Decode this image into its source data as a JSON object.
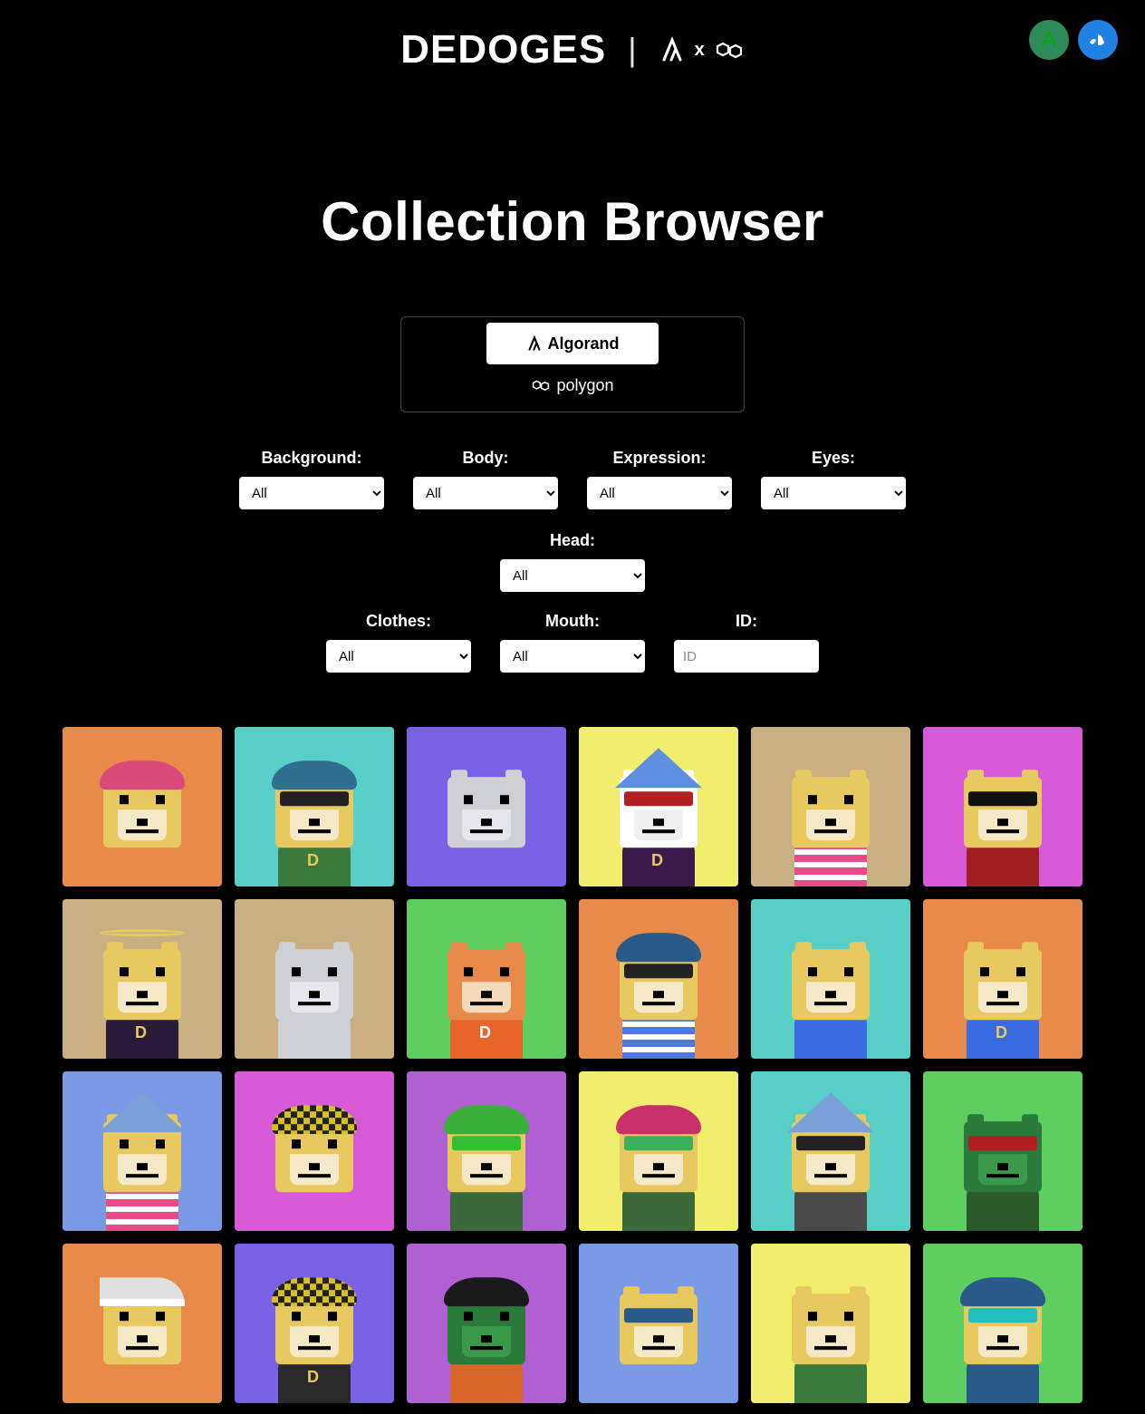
{
  "header": {
    "brand": "DEDOGES"
  },
  "page": {
    "title": "Collection Browser"
  },
  "blockchain": {
    "options": [
      {
        "label": "Algorand",
        "active": true
      },
      {
        "label": "polygon",
        "active": false
      }
    ]
  },
  "filters": {
    "row1": [
      {
        "key": "background",
        "label": "Background:",
        "value": "All"
      },
      {
        "key": "body",
        "label": "Body:",
        "value": "All"
      },
      {
        "key": "expression",
        "label": "Expression:",
        "value": "All"
      },
      {
        "key": "eyes",
        "label": "Eyes:",
        "value": "All"
      },
      {
        "key": "head",
        "label": "Head:",
        "value": "All"
      }
    ],
    "row2": [
      {
        "key": "clothes",
        "label": "Clothes:",
        "value": "All"
      },
      {
        "key": "mouth",
        "label": "Mouth:",
        "value": "All"
      }
    ],
    "id": {
      "label": "ID:",
      "placeholder": "ID"
    }
  },
  "grid": [
    {
      "bg": "#e78a4a",
      "body": "#e8c95f",
      "head": "#e8c95f",
      "snout": "#f5e9c8",
      "hat": "#d84a7a",
      "hatShape": "cap",
      "clothes": "#e78a4a"
    },
    {
      "bg": "#58cfc6",
      "body": "#e8c95f",
      "head": "#e8c95f",
      "snout": "#f5e9c8",
      "hat": "#2f6e8f",
      "hatShape": "cap",
      "clothes": "#3a7a3a",
      "glasses": "#222",
      "letter": "D",
      "letterColor": "#e8c95f"
    },
    {
      "bg": "#7a62e6",
      "body": "#cfcfd6",
      "head": "#cfcfd6",
      "snout": "#e6e6ec",
      "clothes": "#7a62e6"
    },
    {
      "bg": "#f2ee6d",
      "body": "#e8c95f",
      "head": "#ffffff",
      "snout": "#f0f0f0",
      "hat": "#5e8fe0",
      "hatShape": "triangle",
      "hatBorder": "#5e8fe0",
      "clothes": "#3a1a4a",
      "glasses": "#b02020",
      "letter": "D",
      "letterColor": "#e8c95f"
    },
    {
      "bg": "#c9b083",
      "body": "#e8c95f",
      "head": "#e8c95f",
      "snout": "#f5e9c8",
      "clothes": "#e84a8a",
      "stripes": true
    },
    {
      "bg": "#d85ad8",
      "body": "#e8c95f",
      "head": "#e8c95f",
      "snout": "#f5e9c8",
      "glasses": "#111",
      "clothes": "#a02020"
    },
    {
      "bg": "#c9b083",
      "body": "#e8c95f",
      "head": "#e8c95f",
      "snout": "#f5e9c8",
      "hat": "#e8c95f",
      "hatShape": "halo",
      "clothes": "#2a1a3a",
      "letter": "D",
      "letterColor": "#e8c95f"
    },
    {
      "bg": "#c9b083",
      "body": "#cfcfd6",
      "head": "#cfcfd6",
      "snout": "#e6e6ec",
      "clothes": "#cfcfd6"
    },
    {
      "bg": "#5ecf5e",
      "body": "#e88a4a",
      "head": "#e88a4a",
      "snout": "#f5d9b8",
      "clothes": "#e8652a",
      "letter": "D",
      "letterColor": "#fff"
    },
    {
      "bg": "#e78a4a",
      "body": "#e8c95f",
      "head": "#e8c95f",
      "snout": "#f5e9c8",
      "hat": "#2a5a8a",
      "hatShape": "cap",
      "glasses": "#222",
      "clothes": "#4a7ae0",
      "stripes": true
    },
    {
      "bg": "#58cfc6",
      "body": "#b58a4a",
      "head": "#e8c95f",
      "snout": "#f5e9c8",
      "clothes": "#3a6ae0"
    },
    {
      "bg": "#e78a4a",
      "body": "#e8c95f",
      "head": "#e8c95f",
      "snout": "#f5e9c8",
      "clothes": "#3a6ae0",
      "letter": "D",
      "letterColor": "#e8c95f"
    },
    {
      "bg": "#7a9ae6",
      "body": "#e8c95f",
      "head": "#e8c95f",
      "snout": "#f5e9c8",
      "hat": "#7aa0d8",
      "hatShape": "triangle",
      "hatBorder": "#7aa0d8",
      "clothes": "#e84a8a",
      "stripes": true
    },
    {
      "bg": "#d85ad8",
      "body": "#e8c95f",
      "head": "#e8c95f",
      "snout": "#f5e9c8",
      "hat": "#d8c020",
      "hatShape": "checker",
      "clothes": "#d85ad8"
    },
    {
      "bg": "#b060d0",
      "body": "#e8c95f",
      "head": "#e8c95f",
      "snout": "#f5e9c8",
      "hat": "#3ab03a",
      "hatShape": "cap",
      "glasses": "#30c030",
      "clothes": "#3a6a3a"
    },
    {
      "bg": "#f2ee6d",
      "body": "#e8c95f",
      "head": "#e8c95f",
      "snout": "#f5e9c8",
      "hat": "#c8306a",
      "hatShape": "cap",
      "glasses": "#3ab05a",
      "clothes": "#3a6a3a"
    },
    {
      "bg": "#58cfc6",
      "body": "#e8c95f",
      "head": "#e8c95f",
      "snout": "#f5e9c8",
      "hat": "#7aa0d8",
      "hatShape": "triangle",
      "hatBorder": "#7aa0d8",
      "glasses": "#222",
      "clothes": "#4a4a4a"
    },
    {
      "bg": "#5ecf5e",
      "body": "#2a7a3a",
      "head": "#2a7a3a",
      "snout": "#3a9a4a",
      "glasses": "#b02020",
      "clothes": "#2a5a2a"
    },
    {
      "bg": "#e78a4a",
      "body": "#e8c95f",
      "head": "#e8c95f",
      "snout": "#f5e9c8",
      "hat": "#e0e0e0",
      "hatShape": "santa",
      "clothes": "#e78a4a"
    },
    {
      "bg": "#7a62e6",
      "body": "#e8c95f",
      "head": "#e8c95f",
      "snout": "#f5e9c8",
      "hat": "#d8c020",
      "hatShape": "checker",
      "clothes": "#2a2a2a",
      "letter": "D",
      "letterColor": "#e8c95f"
    },
    {
      "bg": "#b060d0",
      "body": "#2a7a3a",
      "head": "#2a7a3a",
      "snout": "#3a9a4a",
      "hat": "#1a1a1a",
      "hatShape": "cap",
      "clothes": "#d8652a"
    },
    {
      "bg": "#7a9ae6",
      "body": "#e8c95f",
      "head": "#e8c95f",
      "snout": "#f5e9c8",
      "glasses": "#2a5a8a",
      "clothes": "#7a9ae6"
    },
    {
      "bg": "#f2ee6d",
      "body": "#e8c95f",
      "head": "#e8c95f",
      "snout": "#f5e9c8",
      "clothes": "#3a7a3a"
    },
    {
      "bg": "#5ecf5e",
      "body": "#e8c95f",
      "head": "#e8c95f",
      "snout": "#f5e9c8",
      "hat": "#2a5a8a",
      "hatShape": "cap",
      "glasses": "#20c0c0",
      "clothes": "#2a5a8a"
    }
  ]
}
